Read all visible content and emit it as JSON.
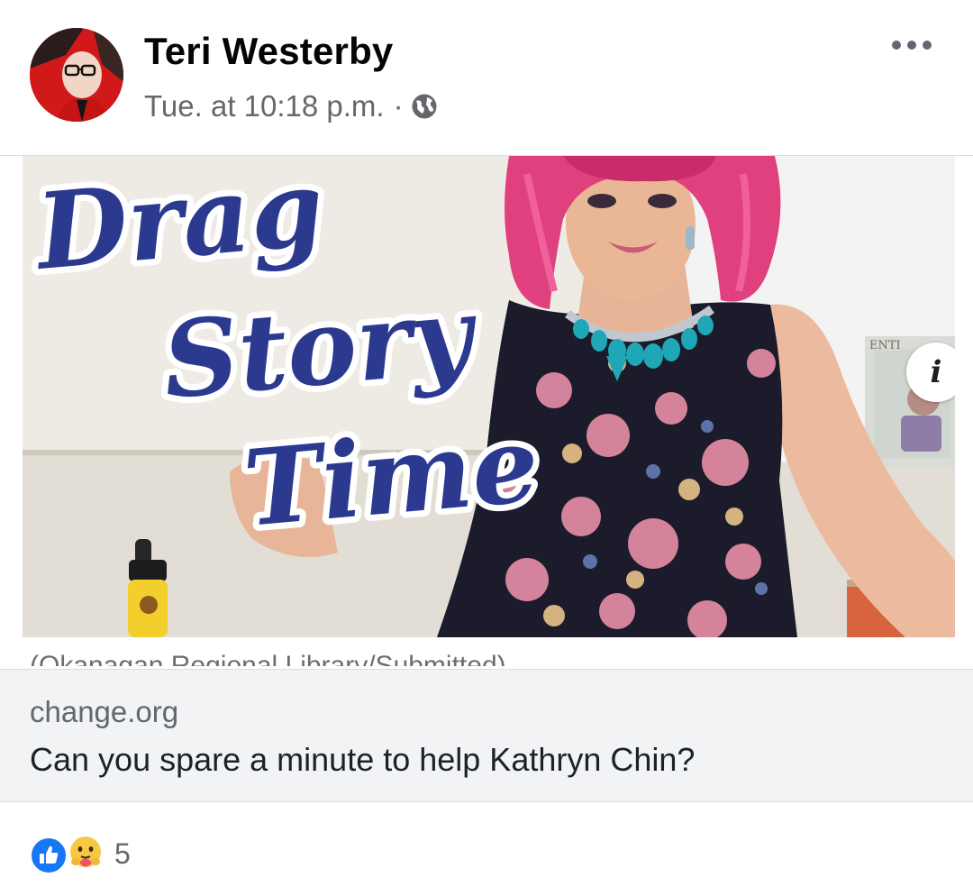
{
  "post": {
    "author": "Teri Westerby",
    "timestamp": "Tue. at 10:18 p.m.",
    "separator": "·",
    "privacy_icon": "globe-icon",
    "menu_icon": "more-options-icon"
  },
  "link_preview": {
    "image_text": [
      "Drag",
      "Story",
      "Time"
    ],
    "shelf_book_text": "ENTI",
    "caption": "(Okanagan Regional Library/Submitted)",
    "info_label": "i",
    "domain": "change.org",
    "title": "Can you spare a minute to help Kathryn Chin?"
  },
  "reactions": {
    "types": [
      "like-icon",
      "care-icon"
    ],
    "count": "5"
  },
  "colors": {
    "accent_blue": "#1877f2",
    "drag_text_blue": "#2b3a8f",
    "secondary_text": "#65676b",
    "link_bg": "#f2f3f5",
    "avatar_red": "#d11919"
  }
}
